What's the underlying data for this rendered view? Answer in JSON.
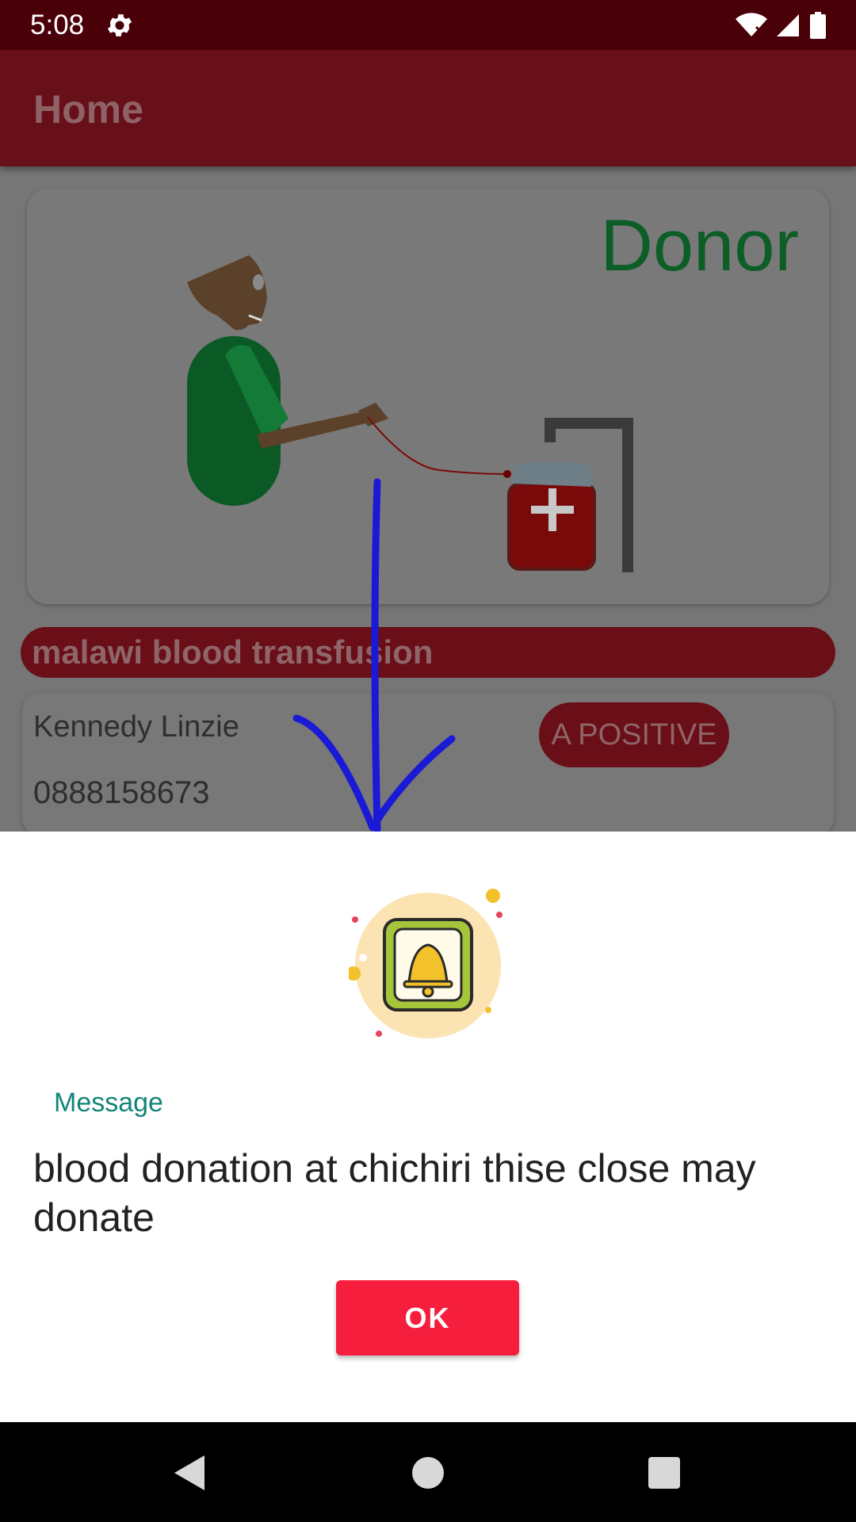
{
  "status_bar": {
    "time": "5:08",
    "icons": [
      "gear-icon",
      "wifi-icon",
      "signal-icon",
      "battery-icon"
    ]
  },
  "app_bar": {
    "title": "Home"
  },
  "donor_card": {
    "title": "Donor",
    "illustration": "donor-blood-donation-illustration"
  },
  "org_banner": {
    "name": "malawi blood transfusion"
  },
  "donor_entry": {
    "name": "Kennedy Linzie",
    "phone": "0888158673",
    "blood_type": "A POSITIVE"
  },
  "dialog": {
    "icon": "bell-icon",
    "label": "Message",
    "message": "blood donation at chichiri thise close may donate",
    "ok_label": "OK"
  },
  "nav_bar": {
    "buttons": [
      "back-icon",
      "home-icon",
      "recents-icon"
    ]
  },
  "colors": {
    "status_bar": "#4a0008",
    "app_bar": "#681019",
    "accent_red": "#f51f3d",
    "label_teal": "#12857a",
    "donor_green": "#0d5d27",
    "gesture_arrow": "#1a1ad6"
  }
}
